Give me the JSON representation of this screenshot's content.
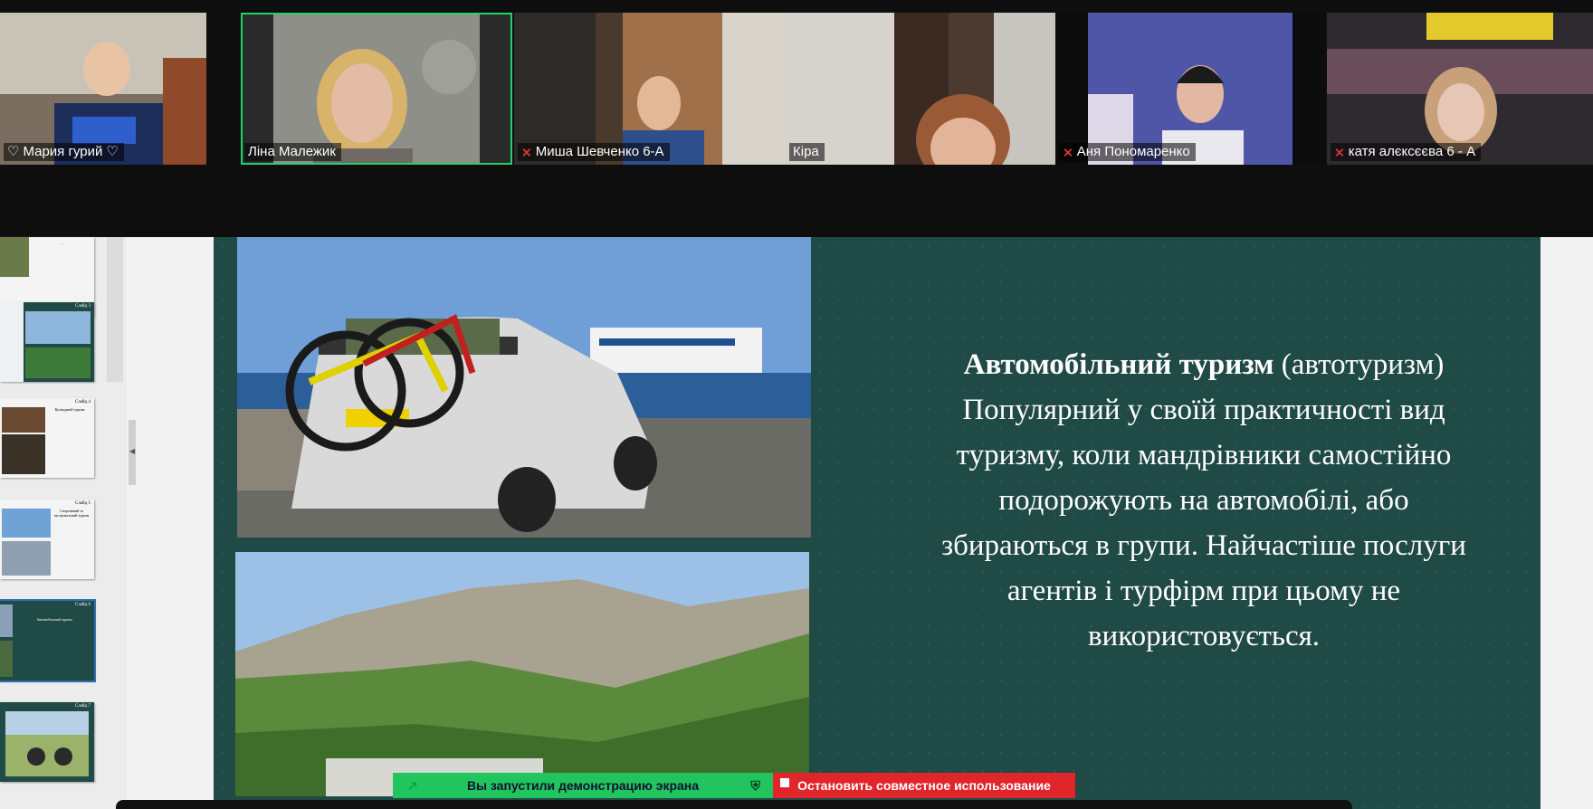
{
  "participants": [
    {
      "name": "Мария гурий",
      "muted": false,
      "active": false
    },
    {
      "name": "Ліна Малежик",
      "muted": false,
      "active": true
    },
    {
      "name": "Миша Шевченко 6-А",
      "muted": true,
      "active": false
    },
    {
      "name": "Кіра",
      "muted": false,
      "active": false
    },
    {
      "name": "Аня Пономаренко",
      "muted": true,
      "active": false
    },
    {
      "name": "катя алєксєєва 6 - А",
      "muted": true,
      "active": false
    }
  ],
  "thumbnails": [
    {
      "num": "",
      "text": "..."
    },
    {
      "num": "Слайд 3",
      "text": ""
    },
    {
      "num": "Слайд 4",
      "text": "Культурний туризм"
    },
    {
      "num": "Слайд 5",
      "text": "Спортивний та екстремальний туризм"
    },
    {
      "num": "Слайд 6",
      "text": "Автомобільний туризм"
    },
    {
      "num": "Слайд 7",
      "text": ""
    }
  ],
  "slide": {
    "title_bold": "Автомобільний туризм",
    "title_rest": " (автотуризм)",
    "body": "Популярний у своїй практичності вид туризму, коли мандрівники самостійно подорожують на автомобілі, або збираються в групи. Найчастіше послуги агентів і турфірм при цьому не використовується."
  },
  "share": {
    "status": "Вы запустили демонстрацию экрана",
    "stop": "Остановить совместное использование"
  },
  "icons": {
    "heart": "heart-icon",
    "muted_mic": "muted-mic-icon",
    "shield": "shield-icon"
  }
}
